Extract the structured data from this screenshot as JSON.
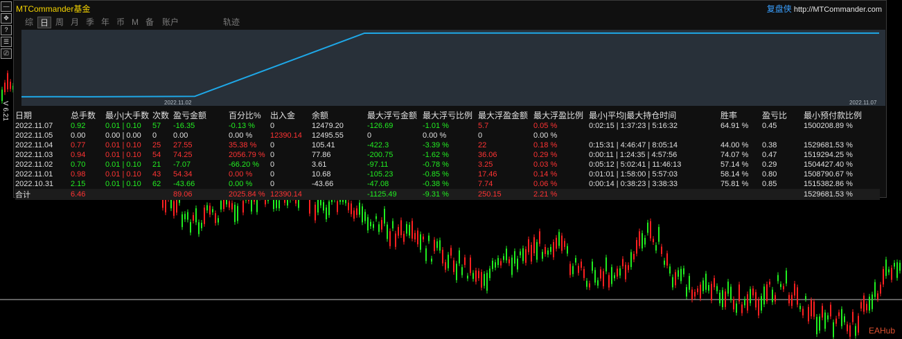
{
  "app_title": "MTCommander基金",
  "brand": {
    "name": "复盘侠",
    "url": "http://MTCommander.com"
  },
  "version_label": "V 6.21",
  "toolbar": [
    "—",
    "✥",
    "?",
    "☰",
    "⎚"
  ],
  "tabs": [
    {
      "label": "综",
      "active": false
    },
    {
      "label": "日",
      "active": true
    },
    {
      "label": "周",
      "active": false
    },
    {
      "label": "月",
      "active": false
    },
    {
      "label": "季",
      "active": false
    },
    {
      "label": "年",
      "active": false
    },
    {
      "label": "币",
      "active": false
    },
    {
      "label": "M",
      "active": false
    },
    {
      "label": "备",
      "active": false
    },
    {
      "label": "账户",
      "active": false
    },
    {
      "label": "轨迹",
      "active": false
    }
  ],
  "equity_chart": {
    "start_date_label": "2022.11.02",
    "end_date_label": "2022.11.07",
    "line_color": "#1ea8e8"
  },
  "chart_data": {
    "type": "line",
    "x": [
      "2022.10.31",
      "2022.11.01",
      "2022.11.02",
      "2022.11.03",
      "2022.11.04",
      "2022.11.05",
      "2022.11.07"
    ],
    "series": [
      {
        "values": [
          -43.66,
          -33.0,
          -40.0,
          40.0,
          12466,
          12495.55,
          12479.2
        ]
      }
    ],
    "title": "",
    "xlabel": "",
    "ylabel": ""
  },
  "table": {
    "headers": [
      "日期",
      "总手数",
      "最小|大手数",
      "次数",
      "盈亏金额",
      "百分比%",
      "出入金",
      "余额",
      "最大浮亏金额",
      "最大浮亏比例",
      "最大浮盈金额",
      "最大浮盈比例",
      "最小|平均|最大持仓时间",
      "胜率",
      "盈亏比",
      "最小预付款比例"
    ],
    "rows": [
      {
        "cells": [
          "2022.11.07",
          "0.92",
          "0.01 | 0.10",
          "57",
          "-16.35",
          "-0.13 %",
          "0",
          "12479.20",
          "-126.69",
          "-1.01 %",
          "5.7",
          "0.05 %",
          "0:02:15 | 1:37:23 | 5:16:32",
          "64.91 %",
          "0.45",
          "1500208.89 %"
        ],
        "colors": [
          "w",
          "g",
          "g",
          "g",
          "g",
          "g",
          "w",
          "w",
          "g",
          "g",
          "r",
          "r",
          "w",
          "w",
          "w",
          "w"
        ]
      },
      {
        "cells": [
          "2022.11.05",
          "0.00",
          "0.00 | 0.00",
          "0",
          "0.00",
          "0.00 %",
          "12390.14",
          "12495.55",
          "0",
          "0.00 %",
          "0",
          "0.00 %",
          "",
          "",
          "",
          ""
        ],
        "colors": [
          "w",
          "w",
          "w",
          "w",
          "w",
          "w",
          "r",
          "w",
          "w",
          "w",
          "w",
          "w",
          "w",
          "w",
          "w",
          "w"
        ]
      },
      {
        "cells": [
          "2022.11.04",
          "0.77",
          "0.01 | 0.10",
          "25",
          "27.55",
          "35.38 %",
          "0",
          "105.41",
          "-422.3",
          "-3.39 %",
          "22",
          "0.18 %",
          "0:15:31 | 4:46:47 | 8:05:14",
          "44.00 %",
          "0.38",
          "1529681.53 %"
        ],
        "colors": [
          "w",
          "r",
          "r",
          "r",
          "r",
          "r",
          "w",
          "w",
          "g",
          "g",
          "r",
          "r",
          "w",
          "w",
          "w",
          "w"
        ]
      },
      {
        "cells": [
          "2022.11.03",
          "0.94",
          "0.01 | 0.10",
          "54",
          "74.25",
          "2056.79 %",
          "0",
          "77.86",
          "-200.75",
          "-1.62 %",
          "36.06",
          "0.29 %",
          "0:00:11 | 1:24:35 | 4:57:56",
          "74.07 %",
          "0.47",
          "1519294.25 %"
        ],
        "colors": [
          "w",
          "r",
          "r",
          "r",
          "r",
          "r",
          "w",
          "w",
          "g",
          "g",
          "r",
          "r",
          "w",
          "w",
          "w",
          "w"
        ]
      },
      {
        "cells": [
          "2022.11.02",
          "0.70",
          "0.01 | 0.10",
          "21",
          "-7.07",
          "-66.20 %",
          "0",
          "3.61",
          "-97.11",
          "-0.78 %",
          "3.25",
          "0.03 %",
          "0:05:12 | 5:02:41 | 11:46:13",
          "57.14 %",
          "0.29",
          "1504427.40 %"
        ],
        "colors": [
          "w",
          "g",
          "g",
          "g",
          "g",
          "g",
          "w",
          "w",
          "g",
          "g",
          "r",
          "r",
          "w",
          "w",
          "w",
          "w"
        ]
      },
      {
        "cells": [
          "2022.11.01",
          "0.98",
          "0.01 | 0.10",
          "43",
          "54.34",
          "0.00 %",
          "0",
          "10.68",
          "-105.23",
          "-0.85 %",
          "17.46",
          "0.14 %",
          "0:01:01 | 1:58:00 | 5:57:03",
          "58.14 %",
          "0.80",
          "1508790.67 %"
        ],
        "colors": [
          "w",
          "r",
          "r",
          "r",
          "r",
          "r",
          "w",
          "w",
          "g",
          "g",
          "r",
          "r",
          "w",
          "w",
          "w",
          "w"
        ]
      },
      {
        "cells": [
          "2022.10.31",
          "2.15",
          "0.01 | 0.10",
          "62",
          "-43.66",
          "0.00 %",
          "0",
          "-43.66",
          "-47.08",
          "-0.38 %",
          "7.74",
          "0.06 %",
          "0:00:14 | 0:38:23 | 3:38:33",
          "75.81 %",
          "0.85",
          "1515382.86 %"
        ],
        "colors": [
          "w",
          "g",
          "g",
          "g",
          "g",
          "g",
          "w",
          "w",
          "g",
          "g",
          "r",
          "r",
          "w",
          "w",
          "w",
          "w"
        ]
      }
    ],
    "total": {
      "cells": [
        "合计",
        "6.46",
        "",
        "",
        "89.06",
        "2025.84 %",
        "12390.14",
        "",
        "-1125.49",
        "-9.31 %",
        "250.15",
        "2.21 %",
        "",
        "",
        "",
        "1529681.53 %"
      ],
      "colors": [
        "w",
        "r",
        "w",
        "w",
        "r",
        "r",
        "r",
        "w",
        "g",
        "g",
        "r",
        "r",
        "w",
        "w",
        "w",
        "w"
      ]
    }
  },
  "watermark": "EAHub",
  "colors": {
    "bull": "#ff2020",
    "bear": "#20ee20",
    "background": "#000000"
  }
}
